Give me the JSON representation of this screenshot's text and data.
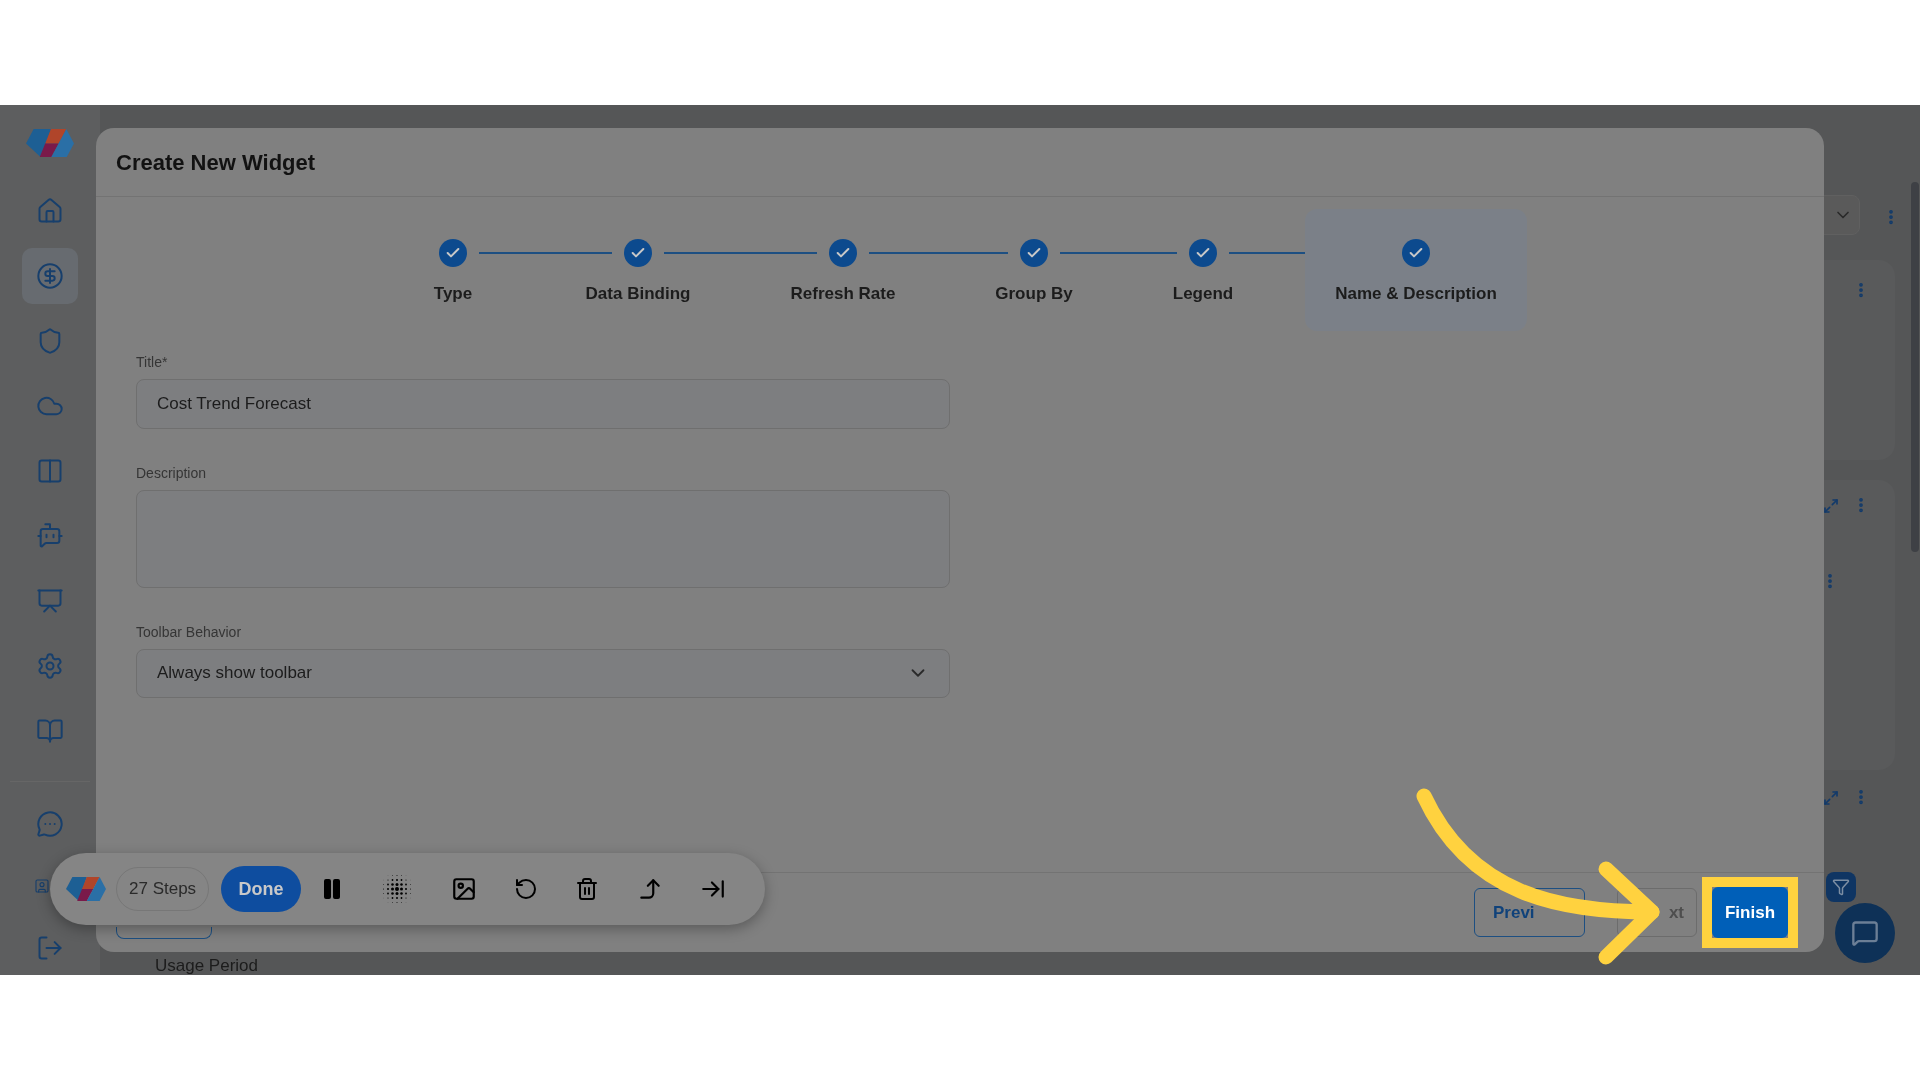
{
  "sidebar": {
    "items": [
      {
        "selected": false
      },
      {
        "selected": true
      },
      {
        "selected": false
      },
      {
        "selected": false
      },
      {
        "selected": false
      },
      {
        "selected": false
      },
      {
        "selected": false
      },
      {
        "selected": false
      },
      {
        "selected": false
      },
      {
        "selected": false
      },
      {
        "selected": false
      },
      {
        "selected": false
      }
    ]
  },
  "background": {
    "label": "Usage Period"
  },
  "dialog": {
    "title": "Create New Widget",
    "steps": [
      {
        "label": "Type",
        "completed": true,
        "selected": false
      },
      {
        "label": "Data Binding",
        "completed": true,
        "selected": false
      },
      {
        "label": "Refresh Rate",
        "completed": true,
        "selected": false
      },
      {
        "label": "Group By",
        "completed": true,
        "selected": false
      },
      {
        "label": "Legend",
        "completed": true,
        "selected": false
      },
      {
        "label": "Name & Description",
        "completed": true,
        "selected": true
      }
    ],
    "fields": [
      {
        "kind": "text",
        "label": "Title*",
        "value": "Cost Trend Forecast"
      },
      {
        "kind": "textarea",
        "label": "Description"
      },
      {
        "kind": "select",
        "label": "Toolbar Behavior",
        "value": "Always show toolbar"
      }
    ],
    "buttons": [
      {
        "kind": "outline",
        "label": "Previ",
        "disabled": false,
        "highlighted": false
      },
      {
        "kind": "outline",
        "label": "xt",
        "disabled": true,
        "highlighted": false
      },
      {
        "kind": "primary",
        "label": "Finish",
        "disabled": false,
        "highlighted": true
      }
    ]
  },
  "recorder": {
    "steps": "27 Steps",
    "done": "Done"
  }
}
